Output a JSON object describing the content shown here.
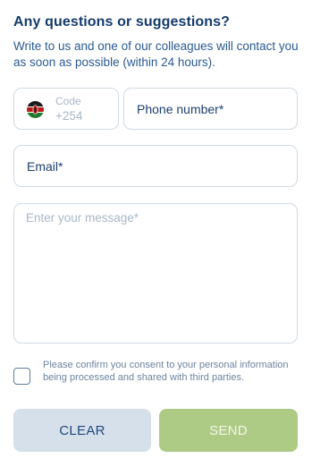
{
  "form": {
    "title": "Any questions or suggestions?",
    "subtitle": "Write to us and one of our colleagues will contact you as soon as possible (within 24 hours).",
    "code": {
      "label": "Code",
      "value": "+254",
      "flag_icon": "kenya-flag-icon"
    },
    "phone": {
      "placeholder": "Phone number*"
    },
    "email": {
      "placeholder": "Email*"
    },
    "message": {
      "placeholder": "Enter your message*"
    },
    "consent": {
      "checked": false,
      "text": "Please confirm you consent to your personal information being processed and shared with third parties."
    },
    "buttons": {
      "clear_label": "CLEAR",
      "send_label": "SEND"
    }
  },
  "colors": {
    "title": "#143b6b",
    "text": "#2a5a92",
    "border": "#cfd9e4",
    "placeholder_muted": "#a9b8c8",
    "clear_button_bg": "#d6e0ea",
    "send_button_bg": "#aecb86"
  }
}
